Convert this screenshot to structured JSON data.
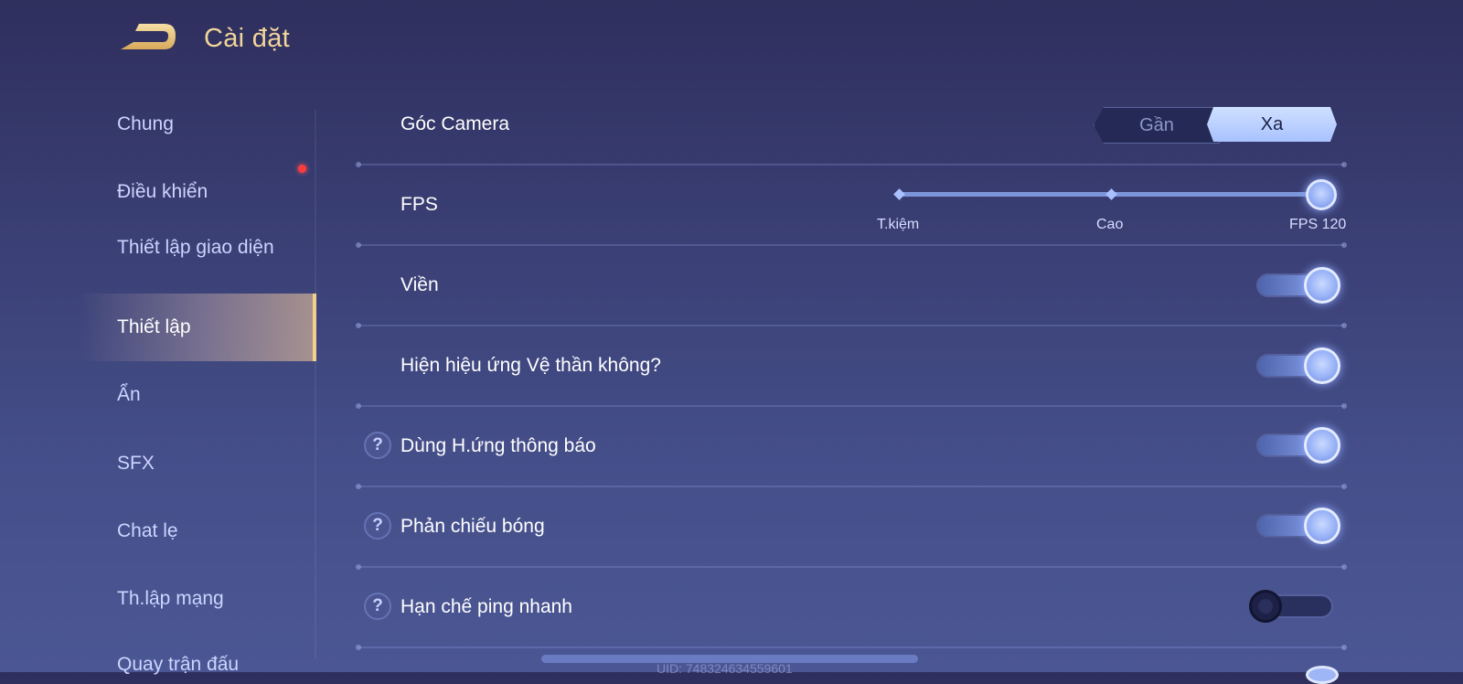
{
  "header": {
    "title": "Cài đặt"
  },
  "sidebar": {
    "items": [
      {
        "label": "Chung"
      },
      {
        "label": "Điều khiển"
      },
      {
        "label": "Thiết lập giao diện"
      },
      {
        "label": "Thiết lập"
      },
      {
        "label": "Ẩn"
      },
      {
        "label": "SFX"
      },
      {
        "label": "Chat lẹ"
      },
      {
        "label": "Th.lập mạng"
      },
      {
        "label": "Quay trận đấu"
      }
    ],
    "active_index": 3
  },
  "settings": {
    "camera": {
      "label": "Góc Camera",
      "options": [
        "Gần",
        "Xa"
      ],
      "selected": "Xa"
    },
    "fps": {
      "label": "FPS",
      "levels": [
        "T.kiệm",
        "Cao",
        "FPS 120"
      ],
      "selected": "FPS 120"
    },
    "toggles": [
      {
        "label": "Viền",
        "on": true,
        "help": false
      },
      {
        "label": "Hiện hiệu ứng Vệ thần không?",
        "on": true,
        "help": false
      },
      {
        "label": "Dùng H.ứng thông báo",
        "on": true,
        "help": true
      },
      {
        "label": "Phản chiếu bóng",
        "on": true,
        "help": true
      },
      {
        "label": "Hạn chế ping nhanh",
        "on": false,
        "help": true
      }
    ]
  },
  "help_glyph": "?",
  "footer": {
    "uid": "UID: 748324634559601"
  },
  "colors": {
    "title_gold": "#f1d59a",
    "accent": "#a9c2ff",
    "active_border": "#f0d08a",
    "notification": "#ff3b3b"
  }
}
